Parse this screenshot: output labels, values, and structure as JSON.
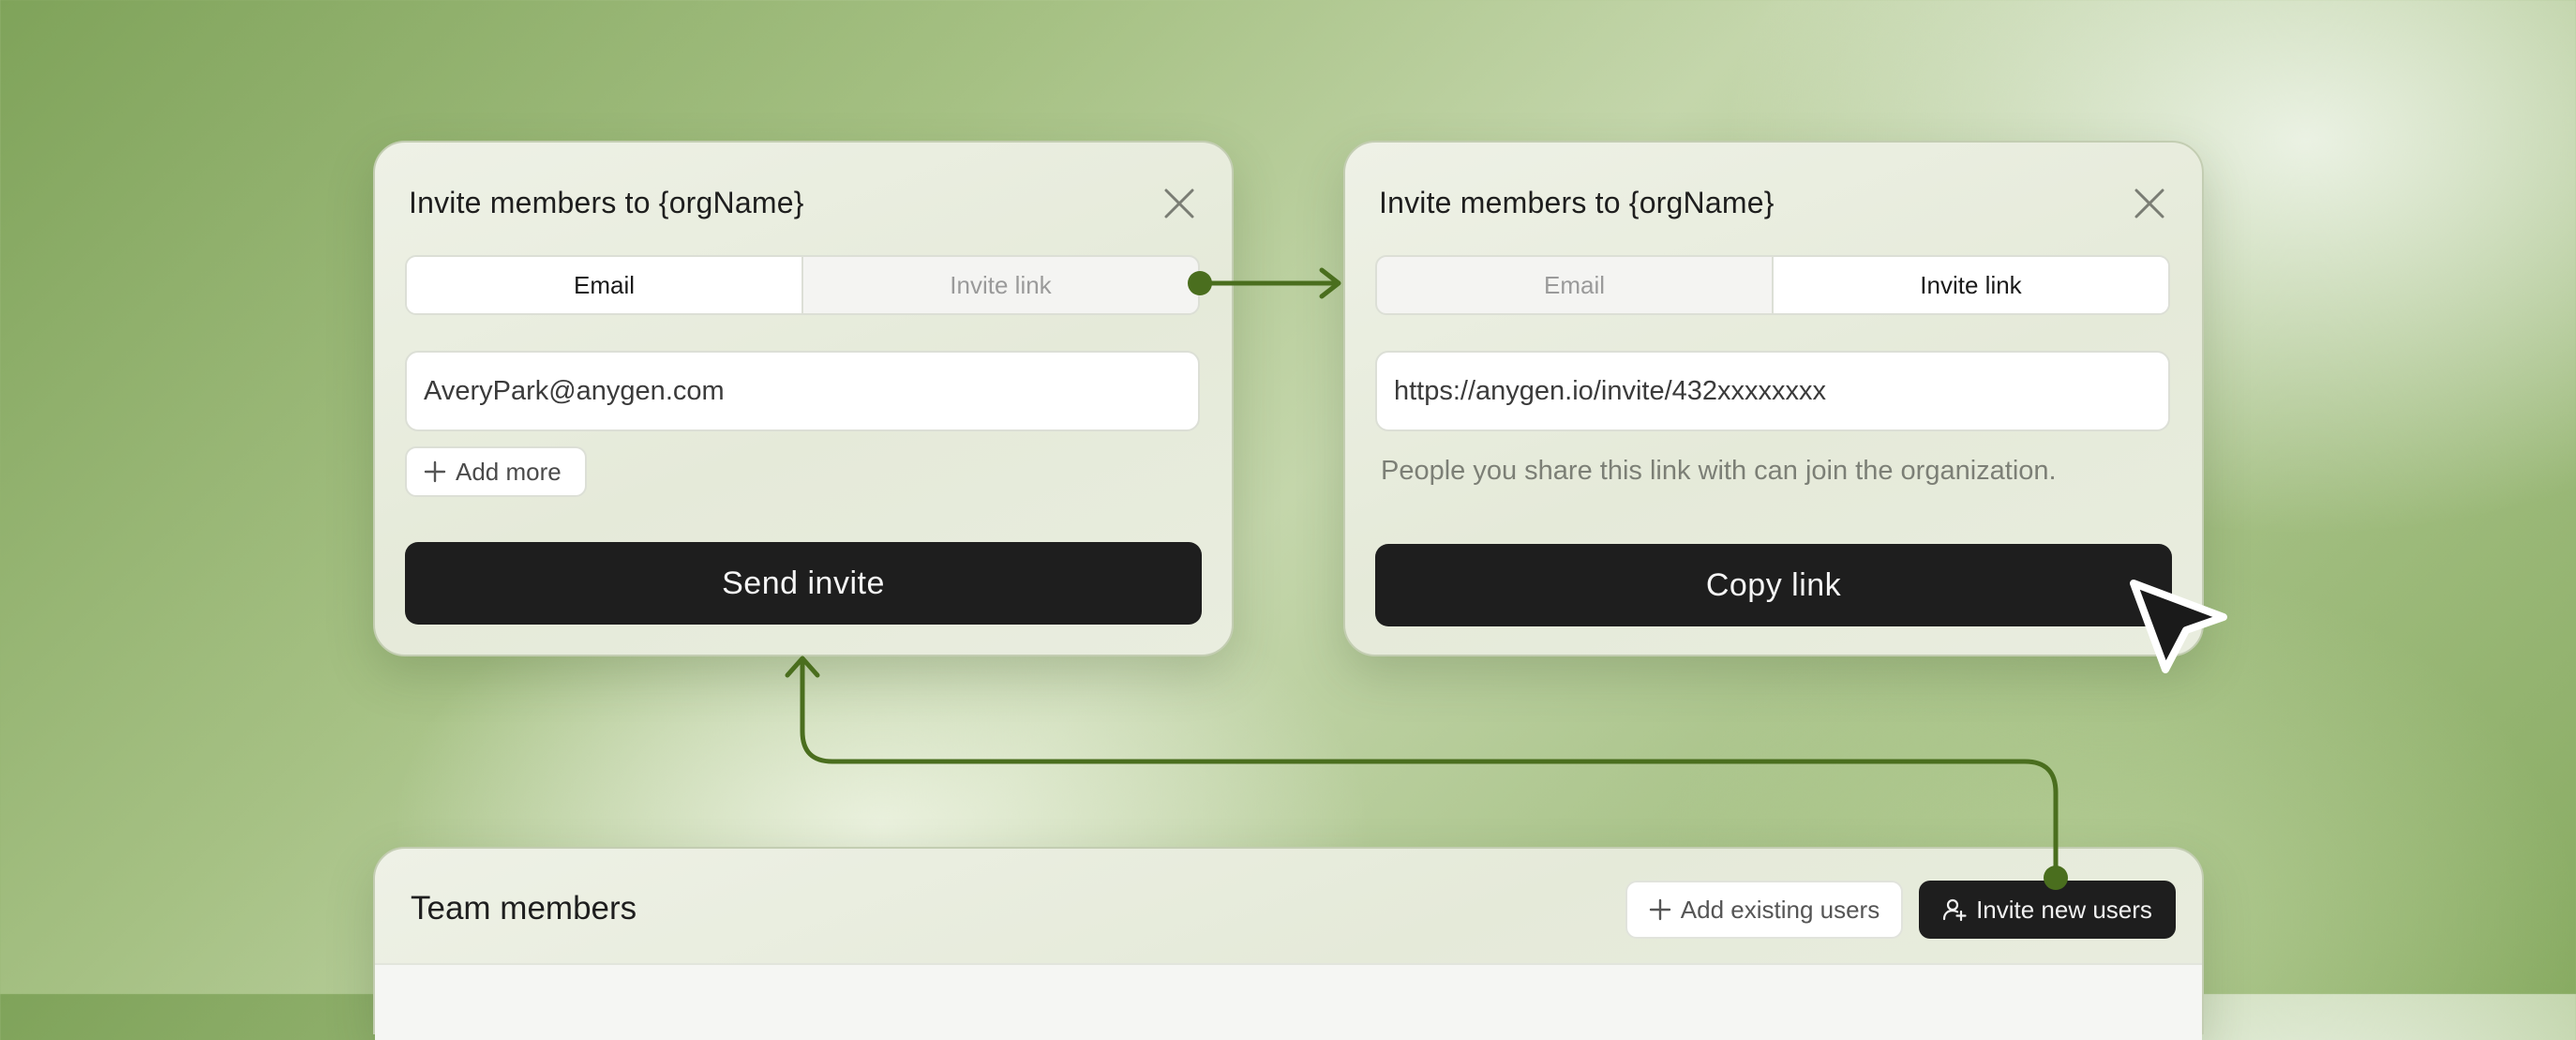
{
  "invite_email_dialog": {
    "title": "Invite members to {orgName}",
    "tabs": [
      {
        "label": "Email",
        "active": true
      },
      {
        "label": "Invite link",
        "active": false
      }
    ],
    "email_value": "AveryPark@anygen.com",
    "add_more_label": "Add more",
    "send_label": "Send invite"
  },
  "invite_link_dialog": {
    "title": "Invite members to {orgName}",
    "tabs": [
      {
        "label": "Email",
        "active": false
      },
      {
        "label": "Invite link",
        "active": true
      }
    ],
    "link_value": "https://anygen.io/invite/432xxxxxxxx",
    "helper_text": "People you share this link with can join the organization.",
    "copy_label": "Copy link"
  },
  "team_members": {
    "title": "Team members",
    "add_existing_label": "Add existing users",
    "invite_new_label": "Invite new users"
  },
  "icons": [
    "close-icon",
    "plus-icon",
    "user-plus-icon",
    "mouse-pointer-icon"
  ],
  "colors": {
    "accent_green": "#4a6e1e",
    "primary_button": "#1e1e1e",
    "dialog_bg": "#e8ecdf"
  }
}
